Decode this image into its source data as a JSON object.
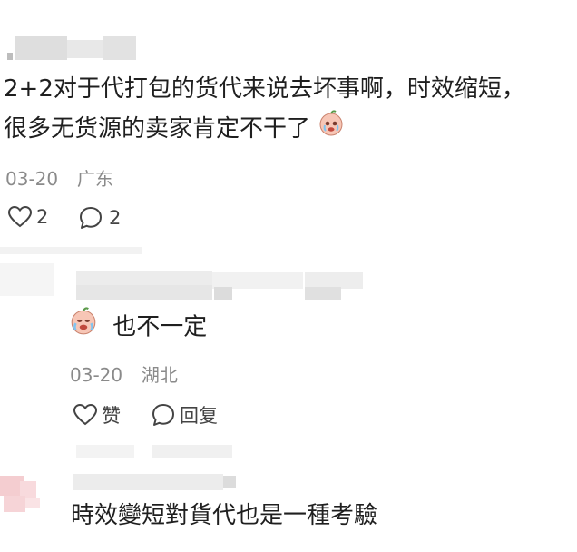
{
  "comment1": {
    "text_line1": "2+2对于代打包的货代来说去坏事啊，时效缩短，",
    "text_line2": "很多无货源的卖家肯定不干了",
    "date": "03-20",
    "location": "广东",
    "like_count": "2",
    "reply_count": "2",
    "emoji_icon": "crying-face-icon"
  },
  "reply1": {
    "text": "也不一定",
    "date": "03-20",
    "location": "湖北",
    "like_label": "赞",
    "reply_label": "回复",
    "emoji_icon": "crying-face-icon"
  },
  "comment2": {
    "text": "時效變短對貨代也是一種考驗"
  }
}
